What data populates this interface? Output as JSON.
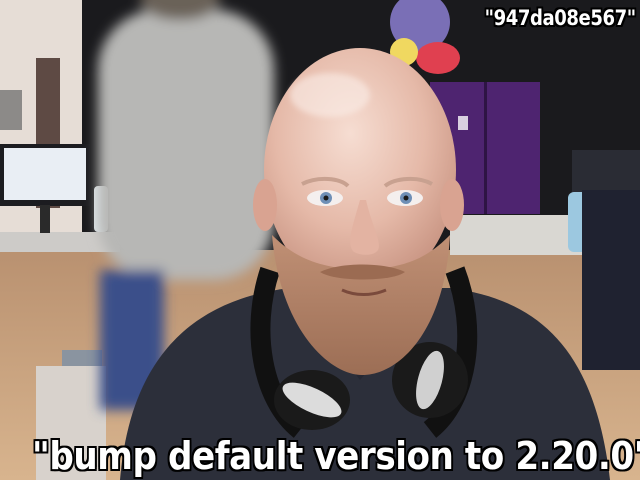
{
  "photo": {
    "subject": "bald bearded man with headphones around neck",
    "palette": {
      "skin": "#e7c0b0",
      "beard": "#b7866a",
      "shirt": "#2c2f3a",
      "wall": "#1a1a1d",
      "floor": "#c9a27c",
      "desk": "#d9d7d2",
      "cabinet": "#5a2a7a"
    }
  },
  "captions": {
    "top_right": "\"947da08e567\"",
    "bottom": "\"bump default version to 2.20.0\""
  }
}
